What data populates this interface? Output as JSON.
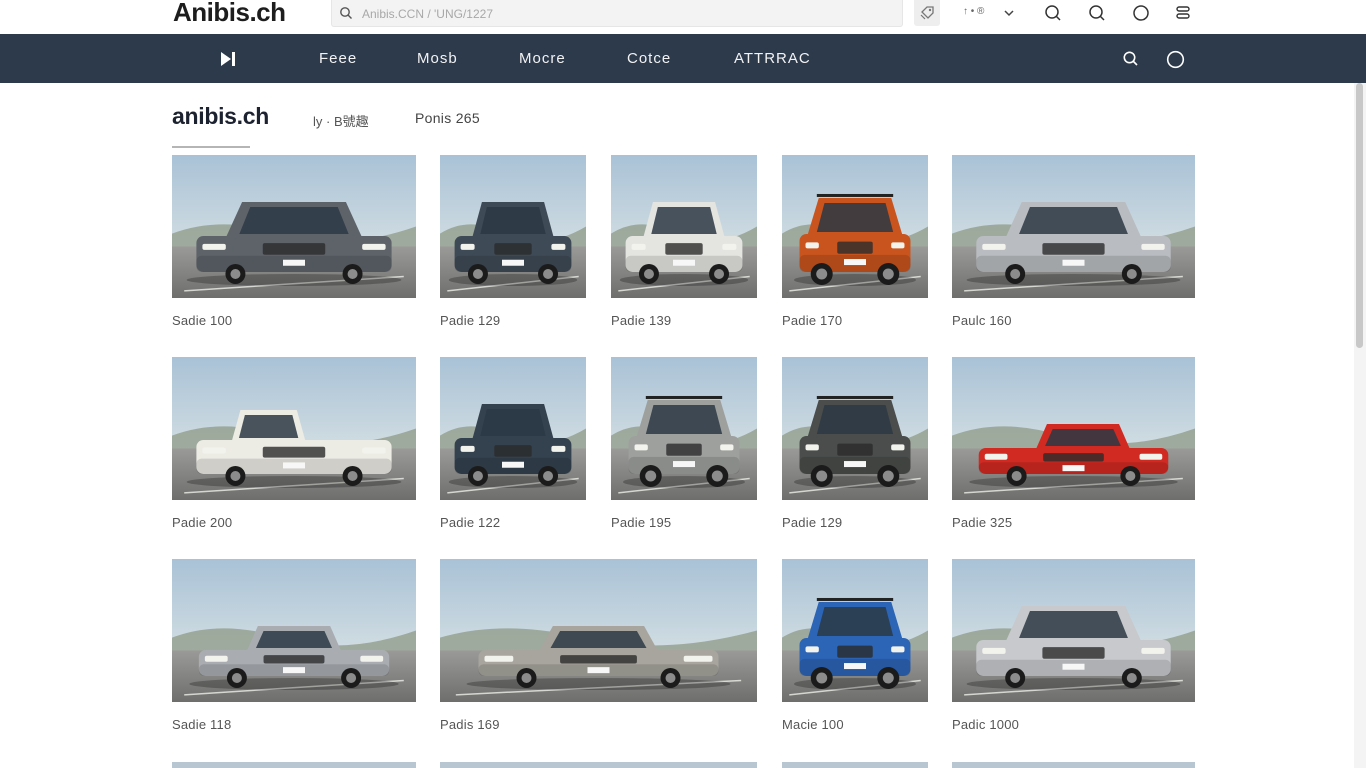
{
  "topbar": {
    "logo": "Anibis.ch",
    "search_placeholder": "Anibis.CCN / 'UNG/1227",
    "lang": "↑ • ®"
  },
  "nav": {
    "items": [
      "Feee",
      "Mosb",
      "Mocre",
      "Cotce",
      "ATTRRAC"
    ]
  },
  "header": {
    "brand": "anibis.ch",
    "sub1": "ly · B號趣",
    "sub2": "Ponis 265"
  },
  "listings": [
    {
      "label": "Sadie 100",
      "color": "#5e636a",
      "kind": "suv"
    },
    {
      "label": "Padie 129",
      "color": "#3f4a57",
      "kind": "suv"
    },
    {
      "label": "Padie 139",
      "color": "#e4e4e1",
      "kind": "suv"
    },
    {
      "label": "Padie 170",
      "color": "#c9541e",
      "kind": "jeep"
    },
    {
      "label": "Paulc 160",
      "color": "#b9bcc0",
      "kind": "suv"
    },
    {
      "label": "Padie 200",
      "color": "#ecebe4",
      "kind": "pickup"
    },
    {
      "label": "Padie 122",
      "color": "#34414f",
      "kind": "suv"
    },
    {
      "label": "Padie 195",
      "color": "#9ea09e",
      "kind": "jeep"
    },
    {
      "label": "Padie 129",
      "color": "#4a4d4b",
      "kind": "jeep"
    },
    {
      "label": "Padie 325",
      "color": "#d02a22",
      "kind": "coupe"
    },
    {
      "label": "Sadie 118",
      "color": "#a9adb2",
      "kind": "sedan"
    },
    {
      "label": "Padis 169",
      "color": "#a7a59d",
      "kind": "sedan"
    },
    {
      "label": "Macie 100",
      "color": "#2c64b6",
      "kind": "jeep"
    },
    {
      "label": "Padic 1000",
      "color": "#c7c9cc",
      "kind": "suv"
    }
  ]
}
